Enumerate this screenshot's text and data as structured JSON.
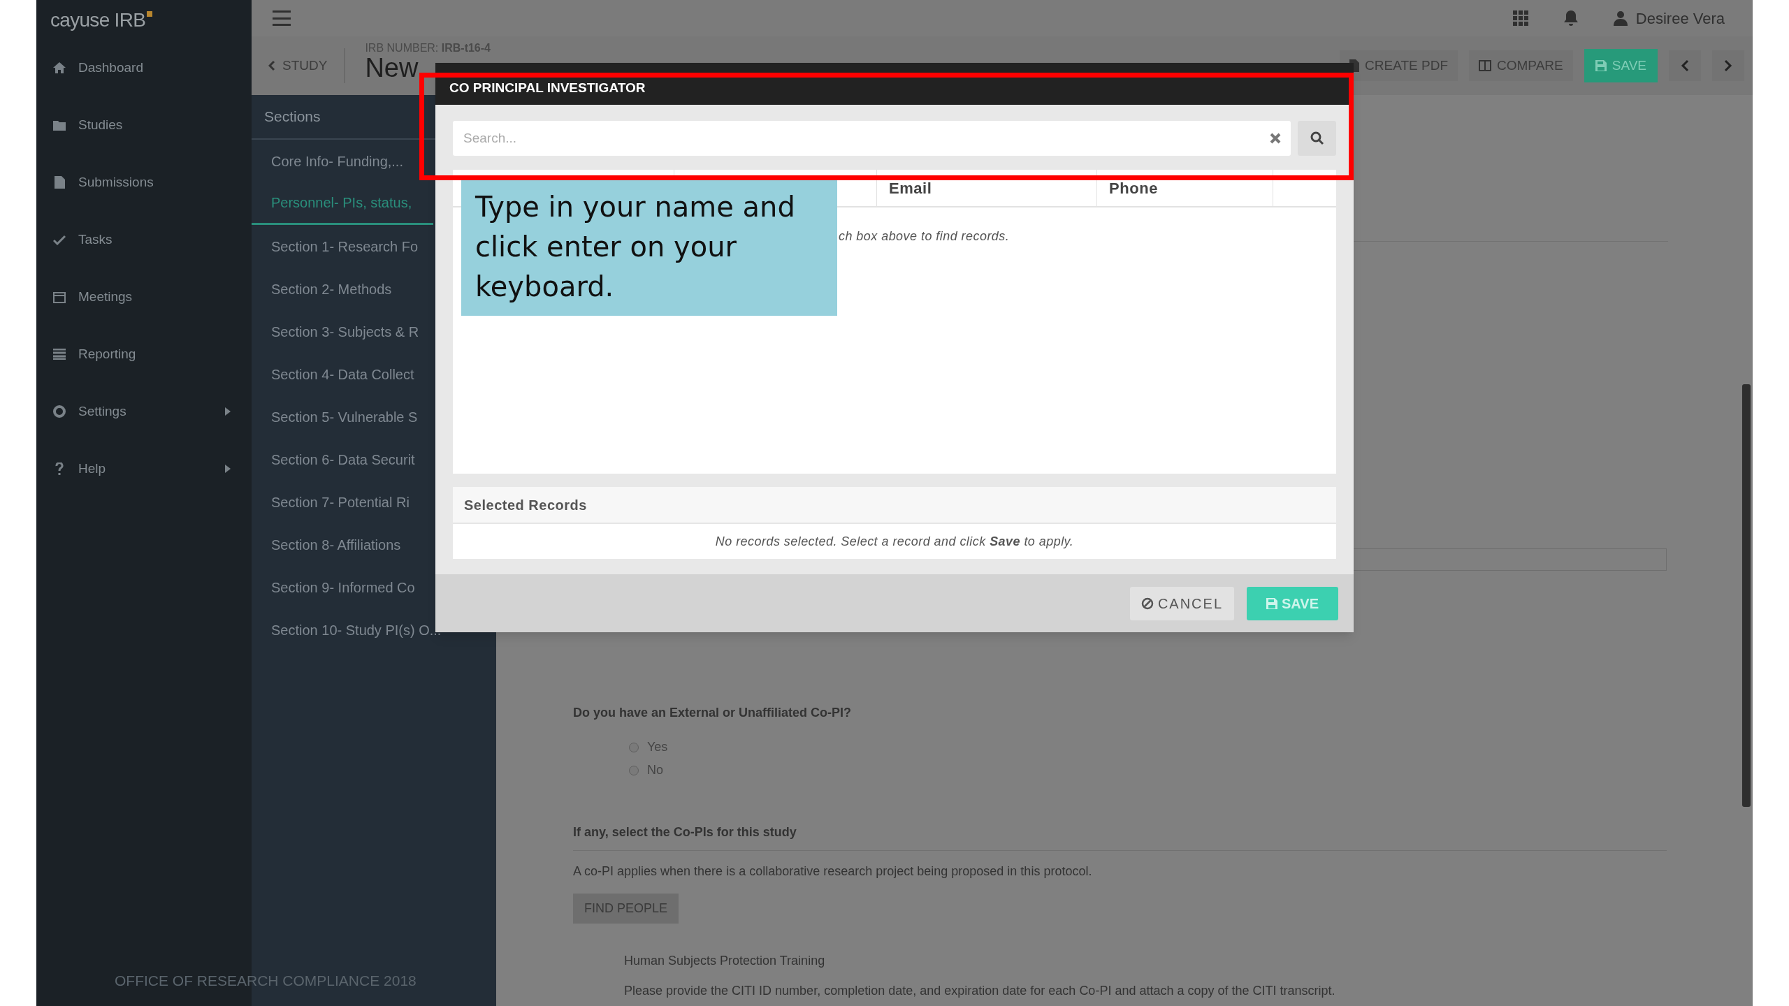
{
  "app": {
    "logo": "cayuse IRB",
    "user": "Desiree Vera"
  },
  "nav": [
    {
      "label": "Dashboard",
      "has_submenu": false
    },
    {
      "label": "Studies",
      "has_submenu": false
    },
    {
      "label": "Submissions",
      "has_submenu": false
    },
    {
      "label": "Tasks",
      "has_submenu": false
    },
    {
      "label": "Meetings",
      "has_submenu": false
    },
    {
      "label": "Reporting",
      "has_submenu": false
    },
    {
      "label": "Settings",
      "has_submenu": true
    },
    {
      "label": "Help",
      "has_submenu": true
    }
  ],
  "study_bar": {
    "back": "STUDY",
    "irb_label": "IRB NUMBER:",
    "irb_number": "IRB-t16-4",
    "title": "New",
    "buttons": [
      {
        "kind": "pdf",
        "label": "CREATE PDF"
      },
      {
        "kind": "compare",
        "label": "COMPARE"
      },
      {
        "kind": "save",
        "label": "SAVE"
      },
      {
        "kind": "prev"
      },
      {
        "kind": "next"
      }
    ]
  },
  "sections": {
    "title": "Sections",
    "items": [
      {
        "label": "Core Info- Funding,...",
        "selected": false
      },
      {
        "label": "Personnel- PIs, status,",
        "selected": true
      },
      {
        "label": "Section 1- Research Fo",
        "selected": false
      },
      {
        "label": "Section 2- Methods",
        "selected": false
      },
      {
        "label": "Section 3- Subjects & R",
        "selected": false
      },
      {
        "label": "Section 4- Data Collect",
        "selected": false
      },
      {
        "label": "Section 5- Vulnerable S",
        "selected": false
      },
      {
        "label": "Section 6- Data Securit",
        "selected": false
      },
      {
        "label": "Section 7- Potential Ri",
        "selected": false
      },
      {
        "label": "Section 8- Affiliations",
        "selected": false
      },
      {
        "label": "Section 9- Informed Co",
        "selected": false
      },
      {
        "label": "Section 10- Study PI(s) O...",
        "selected": false
      }
    ]
  },
  "form": {
    "question": "Do you have an External or Unaffiliated Co-PI?",
    "options": [
      {
        "label": "Yes",
        "selected": false
      },
      {
        "label": "No",
        "selected": false
      }
    ],
    "copi_heading": "If any, select the Co-PIs for this study",
    "copi_help": "A co-PI applies when there is a collaborative research project being proposed in this protocol.",
    "find_button": "FIND PEOPLE",
    "training_heading": "Human Subjects Protection Training",
    "training_help": "Please provide the CITI ID number, completion date, and expiration date for each Co-PI and attach a copy of the CITI transcript."
  },
  "modal": {
    "title": "CO PRINCIPAL INVESTIGATOR",
    "search": {
      "placeholder": "Search..."
    },
    "columns": [
      "Email",
      "Phone"
    ],
    "empty_message": "ch box above to find records.",
    "selected_title": "Selected Records",
    "selected_empty": "No records selected. Select a record and click **Save** to apply.",
    "buttons": [
      {
        "kind": "cancel",
        "label": "CANCEL"
      },
      {
        "kind": "save",
        "label": "SAVE"
      }
    ]
  },
  "callout": {
    "text": "Type in your name and click enter on your keyboard."
  },
  "footer": "OFFICE OF RESEARCH COMPLIANCE 2018"
}
